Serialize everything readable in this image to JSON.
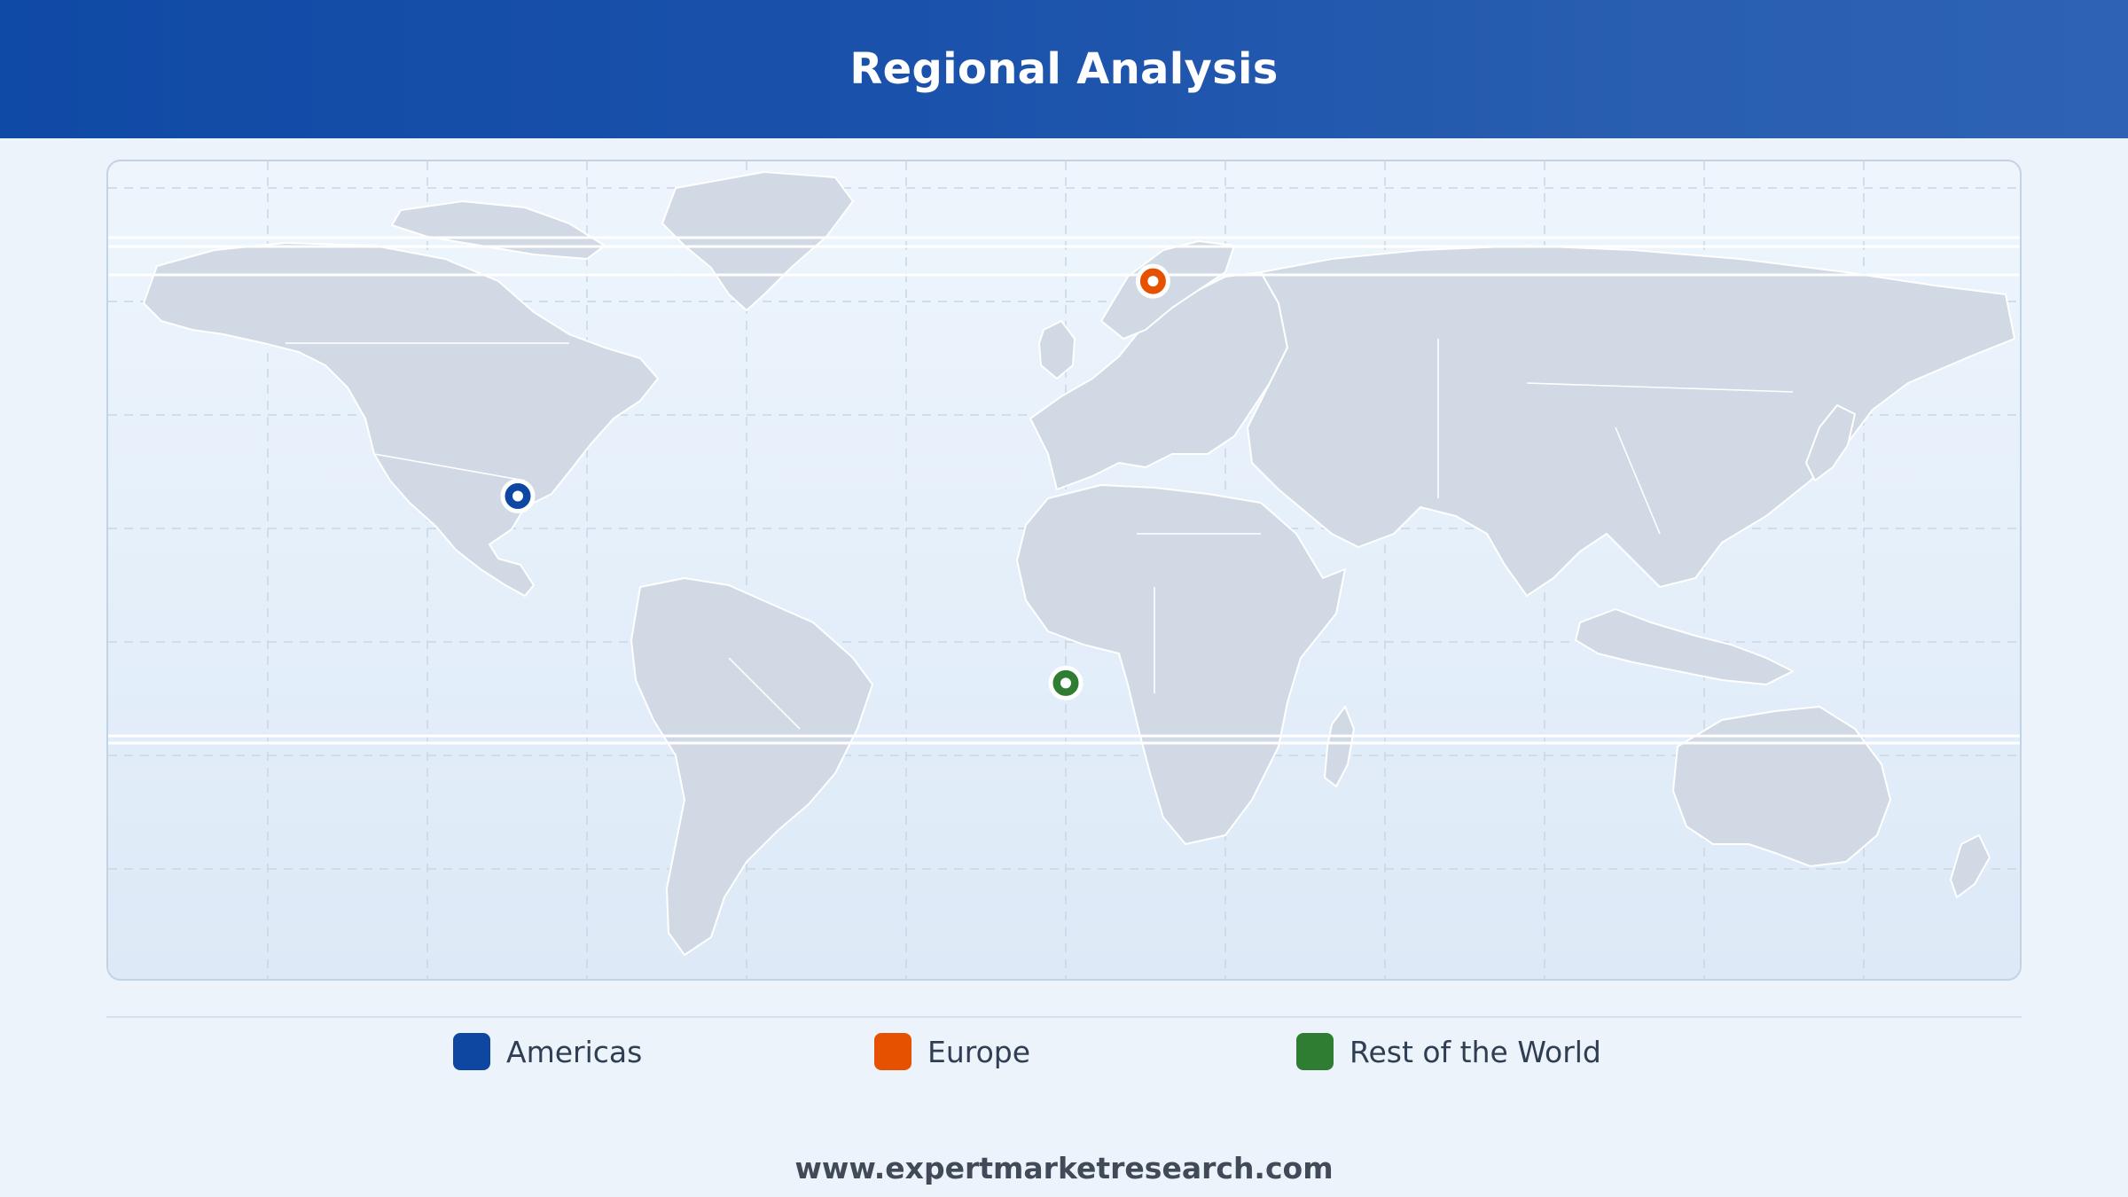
{
  "header": {
    "title": "Regional Analysis"
  },
  "map": {
    "markers": [
      {
        "region": "Americas",
        "lat": 23.5,
        "lon": -103.0,
        "color": "#0d47a1"
      },
      {
        "region": "Europe",
        "lat": 48.2,
        "lon": 16.4,
        "color": "#e65100"
      },
      {
        "region": "Rest of the World",
        "lat": 2.0,
        "lon": 0.0,
        "color": "#2e7d32"
      }
    ]
  },
  "legend": {
    "items": [
      {
        "label": "Americas",
        "color": "#0d47a1"
      },
      {
        "label": "Europe",
        "color": "#e65100"
      },
      {
        "label": "Rest of the World",
        "color": "#2e7d32"
      }
    ]
  },
  "footer": {
    "url": "www.expertmarketresearch.com"
  }
}
